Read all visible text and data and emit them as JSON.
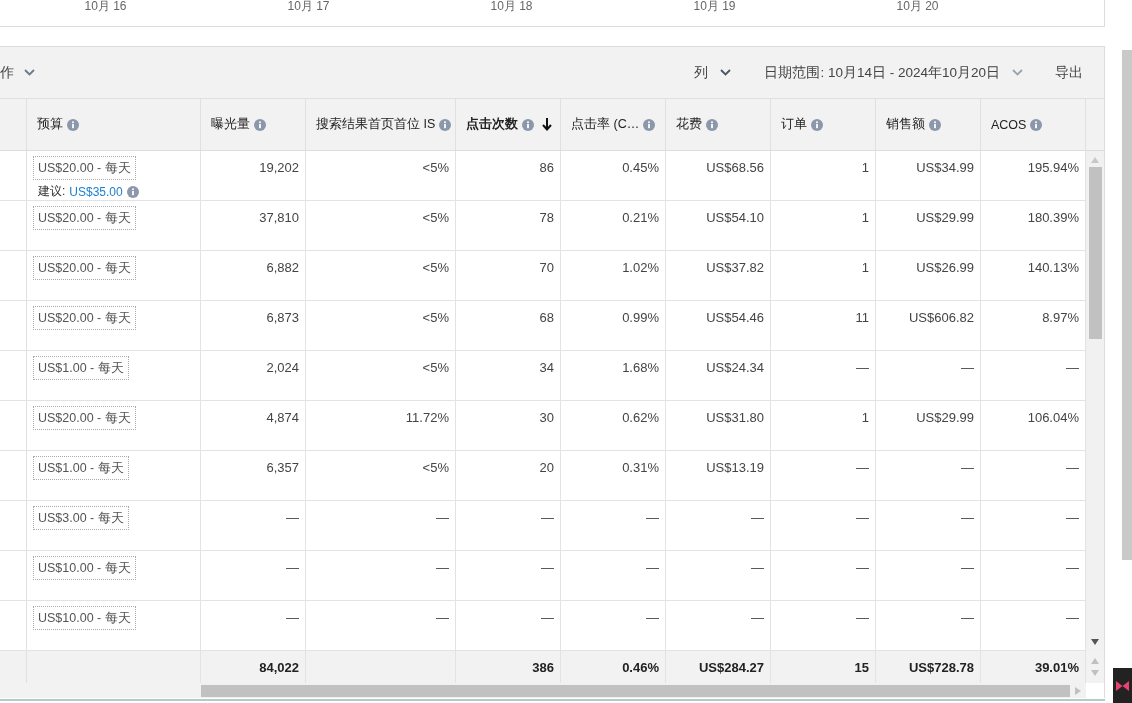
{
  "chart": {
    "x_labels": [
      "10月 16",
      "10月 17",
      "10月 18",
      "10月 19",
      "10月 20"
    ]
  },
  "toolbar": {
    "actions_menu": {
      "label": "作"
    },
    "columns_menu": {
      "label": "列"
    },
    "date_range": {
      "label": "日期范围: 10月14日 - 2024年10月20日"
    },
    "export_button": {
      "label": "导出"
    }
  },
  "table": {
    "columns": [
      {
        "label": "预算",
        "sorted": false
      },
      {
        "label": "曝光量",
        "sorted": false
      },
      {
        "label": "搜索结果首页首位 IS",
        "sorted": false
      },
      {
        "label": "点击次数",
        "sorted": true
      },
      {
        "label": "点击率 (C…",
        "sorted": false
      },
      {
        "label": "花费",
        "sorted": false
      },
      {
        "label": "订单",
        "sorted": false
      },
      {
        "label": "销售额",
        "sorted": false
      },
      {
        "label": "ACOS",
        "sorted": false
      }
    ],
    "rows": [
      {
        "budget": "US$20.00 - 每天",
        "suggestion": {
          "label": "建议:",
          "value": "US$35.00"
        },
        "cells": [
          "19,202",
          "<5%",
          "86",
          "0.45%",
          "US$68.56",
          "1",
          "US$34.99",
          "195.94%"
        ]
      },
      {
        "budget": "US$20.00 - 每天",
        "cells": [
          "37,810",
          "<5%",
          "78",
          "0.21%",
          "US$54.10",
          "1",
          "US$29.99",
          "180.39%"
        ]
      },
      {
        "budget": "US$20.00 - 每天",
        "cells": [
          "6,882",
          "<5%",
          "70",
          "1.02%",
          "US$37.82",
          "1",
          "US$26.99",
          "140.13%"
        ]
      },
      {
        "budget": "US$20.00 - 每天",
        "cells": [
          "6,873",
          "<5%",
          "68",
          "0.99%",
          "US$54.46",
          "11",
          "US$606.82",
          "8.97%"
        ]
      },
      {
        "budget": "US$1.00 - 每天",
        "cells": [
          "2,024",
          "<5%",
          "34",
          "1.68%",
          "US$24.34",
          "—",
          "—",
          "—"
        ]
      },
      {
        "budget": "US$20.00 - 每天",
        "cells": [
          "4,874",
          "11.72%",
          "30",
          "0.62%",
          "US$31.80",
          "1",
          "US$29.99",
          "106.04%"
        ]
      },
      {
        "budget": "US$1.00 - 每天",
        "cells": [
          "6,357",
          "<5%",
          "20",
          "0.31%",
          "US$13.19",
          "—",
          "—",
          "—"
        ]
      },
      {
        "budget": "US$3.00 - 每天",
        "cells": [
          "—",
          "—",
          "—",
          "—",
          "—",
          "—",
          "—",
          "—"
        ]
      },
      {
        "budget": "US$10.00 - 每天",
        "cells": [
          "—",
          "—",
          "—",
          "—",
          "—",
          "—",
          "—",
          "—"
        ]
      },
      {
        "budget": "US$10.00 - 每天",
        "cells": [
          "—",
          "—",
          "—",
          "—",
          "—",
          "—",
          "—",
          "—"
        ]
      }
    ],
    "totals": {
      "impressions": "84,022",
      "clicks": "386",
      "ctr": "0.46%",
      "spend": "US$284.27",
      "orders": "15",
      "sales": "US$728.78",
      "acos": "39.01%"
    }
  }
}
